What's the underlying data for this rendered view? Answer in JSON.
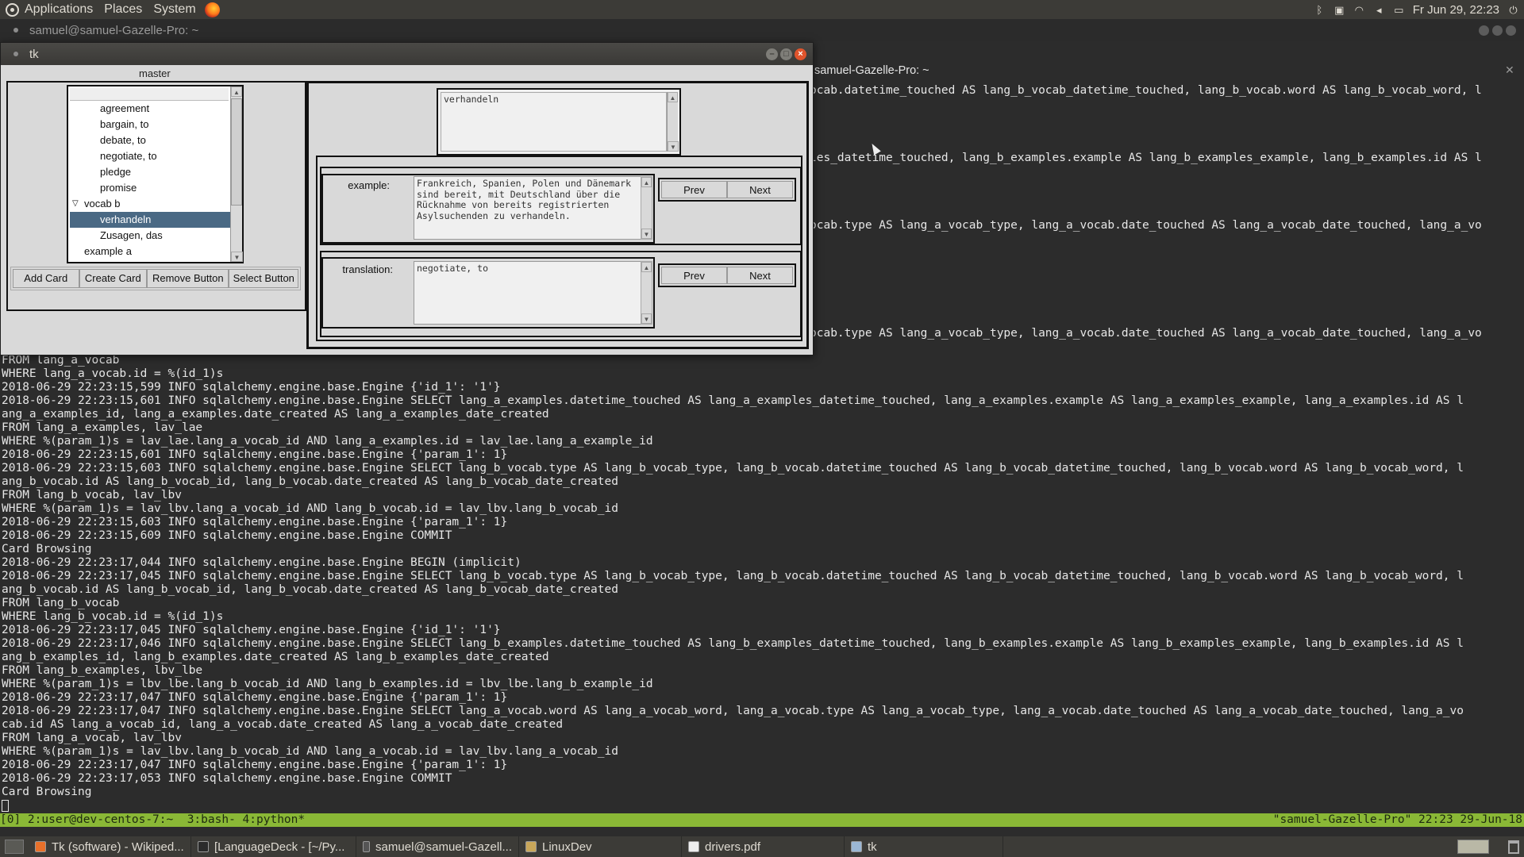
{
  "top_panel": {
    "menus": [
      "Applications",
      "Places",
      "System"
    ],
    "clock": "Fr Jun 29, 22:23"
  },
  "terminal": {
    "title": "samuel@samuel-Gazelle-Pro: ~",
    "right_title": "samuel-Gazelle-Pro: ~",
    "right_lines": [
      "ocab.datetime_touched AS lang_b_vocab_datetime_touched, lang_b_vocab.word AS lang_b_vocab_word, l",
      "",
      "",
      "",
      "",
      "les_datetime_touched, lang_b_examples.example AS lang_b_examples_example, lang_b_examples.id AS l",
      "",
      "",
      "",
      "",
      "ocab.type AS lang_a_vocab_type, lang_a_vocab.date_touched AS lang_a_vocab_date_touched, lang_a_vo",
      "",
      "",
      "",
      "",
      "",
      "",
      "",
      "ocab.type AS lang_a_vocab_type, lang_a_vocab.date_touched AS lang_a_vocab_date_touched, lang_a_vo"
    ],
    "lines": [
      "FROM lang_a_vocab",
      "WHERE lang_a_vocab.id = %(id_1)s",
      "2018-06-29 22:23:15,599 INFO sqlalchemy.engine.base.Engine {'id_1': '1'}",
      "2018-06-29 22:23:15,601 INFO sqlalchemy.engine.base.Engine SELECT lang_a_examples.datetime_touched AS lang_a_examples_datetime_touched, lang_a_examples.example AS lang_a_examples_example, lang_a_examples.id AS l",
      "ang_a_examples_id, lang_a_examples.date_created AS lang_a_examples_date_created",
      "FROM lang_a_examples, lav_lae",
      "WHERE %(param_1)s = lav_lae.lang_a_vocab_id AND lang_a_examples.id = lav_lae.lang_a_example_id",
      "2018-06-29 22:23:15,601 INFO sqlalchemy.engine.base.Engine {'param_1': 1}",
      "2018-06-29 22:23:15,603 INFO sqlalchemy.engine.base.Engine SELECT lang_b_vocab.type AS lang_b_vocab_type, lang_b_vocab.datetime_touched AS lang_b_vocab_datetime_touched, lang_b_vocab.word AS lang_b_vocab_word, l",
      "ang_b_vocab.id AS lang_b_vocab_id, lang_b_vocab.date_created AS lang_b_vocab_date_created",
      "FROM lang_b_vocab, lav_lbv",
      "WHERE %(param_1)s = lav_lbv.lang_a_vocab_id AND lang_b_vocab.id = lav_lbv.lang_b_vocab_id",
      "2018-06-29 22:23:15,603 INFO sqlalchemy.engine.base.Engine {'param_1': 1}",
      "2018-06-29 22:23:15,609 INFO sqlalchemy.engine.base.Engine COMMIT",
      "Card Browsing",
      "2018-06-29 22:23:17,044 INFO sqlalchemy.engine.base.Engine BEGIN (implicit)",
      "2018-06-29 22:23:17,045 INFO sqlalchemy.engine.base.Engine SELECT lang_b_vocab.type AS lang_b_vocab_type, lang_b_vocab.datetime_touched AS lang_b_vocab_datetime_touched, lang_b_vocab.word AS lang_b_vocab_word, l",
      "ang_b_vocab.id AS lang_b_vocab_id, lang_b_vocab.date_created AS lang_b_vocab_date_created",
      "FROM lang_b_vocab",
      "WHERE lang_b_vocab.id = %(id_1)s",
      "2018-06-29 22:23:17,045 INFO sqlalchemy.engine.base.Engine {'id_1': '1'}",
      "2018-06-29 22:23:17,046 INFO sqlalchemy.engine.base.Engine SELECT lang_b_examples.datetime_touched AS lang_b_examples_datetime_touched, lang_b_examples.example AS lang_b_examples_example, lang_b_examples.id AS l",
      "ang_b_examples_id, lang_b_examples.date_created AS lang_b_examples_date_created",
      "FROM lang_b_examples, lbv_lbe",
      "WHERE %(param_1)s = lbv_lbe.lang_b_vocab_id AND lang_b_examples.id = lbv_lbe.lang_b_example_id",
      "2018-06-29 22:23:17,047 INFO sqlalchemy.engine.base.Engine {'param_1': 1}",
      "2018-06-29 22:23:17,047 INFO sqlalchemy.engine.base.Engine SELECT lang_a_vocab.word AS lang_a_vocab_word, lang_a_vocab.type AS lang_a_vocab_type, lang_a_vocab.date_touched AS lang_a_vocab_date_touched, lang_a_vo",
      "cab.id AS lang_a_vocab_id, lang_a_vocab.date_created AS lang_a_vocab_date_created",
      "FROM lang_a_vocab, lav_lbv",
      "WHERE %(param_1)s = lav_lbv.lang_b_vocab_id AND lang_a_vocab.id = lav_lbv.lang_a_vocab_id",
      "2018-06-29 22:23:17,047 INFO sqlalchemy.engine.base.Engine {'param_1': 1}",
      "2018-06-29 22:23:17,053 INFO sqlalchemy.engine.base.Engine COMMIT",
      "Card Browsing"
    ]
  },
  "tmux": {
    "left": "[0] 2:user@dev-centos-7:~  3:bash- 4:python*",
    "right": "\"samuel-Gazelle-Pro\" 22:23 29-Jun-18"
  },
  "tk_app": {
    "title": "tk",
    "master_label": "master",
    "tree": [
      {
        "label": "agreement",
        "indent": 2
      },
      {
        "label": "bargain, to",
        "indent": 2
      },
      {
        "label": "debate, to",
        "indent": 2
      },
      {
        "label": "negotiate, to",
        "indent": 2
      },
      {
        "label": "pledge",
        "indent": 2
      },
      {
        "label": "promise",
        "indent": 2
      },
      {
        "label": "vocab b",
        "indent": 1,
        "expanded": true
      },
      {
        "label": "verhandeln",
        "indent": 2,
        "selected": true
      },
      {
        "label": "Zusagen, das",
        "indent": 2
      },
      {
        "label": "example a",
        "indent": 1
      }
    ],
    "buttons": {
      "add_card": "Add Card",
      "create_card": "Create Card",
      "remove_button": "Remove Button",
      "select_button": "Select Button"
    },
    "word_text": "verhandeln",
    "example": {
      "label": "example:",
      "text": "Frankreich, Spanien, Polen und Dänemark\nsind bereit, mit Deutschland über die\nRücknahme von bereits registrierten\nAsylsuchenden zu verhandeln.",
      "prev": "Prev",
      "next": "Next"
    },
    "translation": {
      "label": "translation:",
      "text": "negotiate, to",
      "prev": "Prev",
      "next": "Next"
    }
  },
  "taskbar": {
    "tasks": [
      {
        "label": "Tk (software) - Wikiped...",
        "icon": "firefox-icon"
      },
      {
        "label": "[LanguageDeck - [~/Py...",
        "icon": "pycharm-icon"
      },
      {
        "label": "samuel@samuel-Gazell...",
        "icon": "terminal-icon"
      },
      {
        "label": "LinuxDev",
        "icon": "folder-icon"
      },
      {
        "label": "drivers.pdf",
        "icon": "pdf-icon"
      },
      {
        "label": "tk",
        "icon": "tk-window-icon"
      }
    ]
  }
}
